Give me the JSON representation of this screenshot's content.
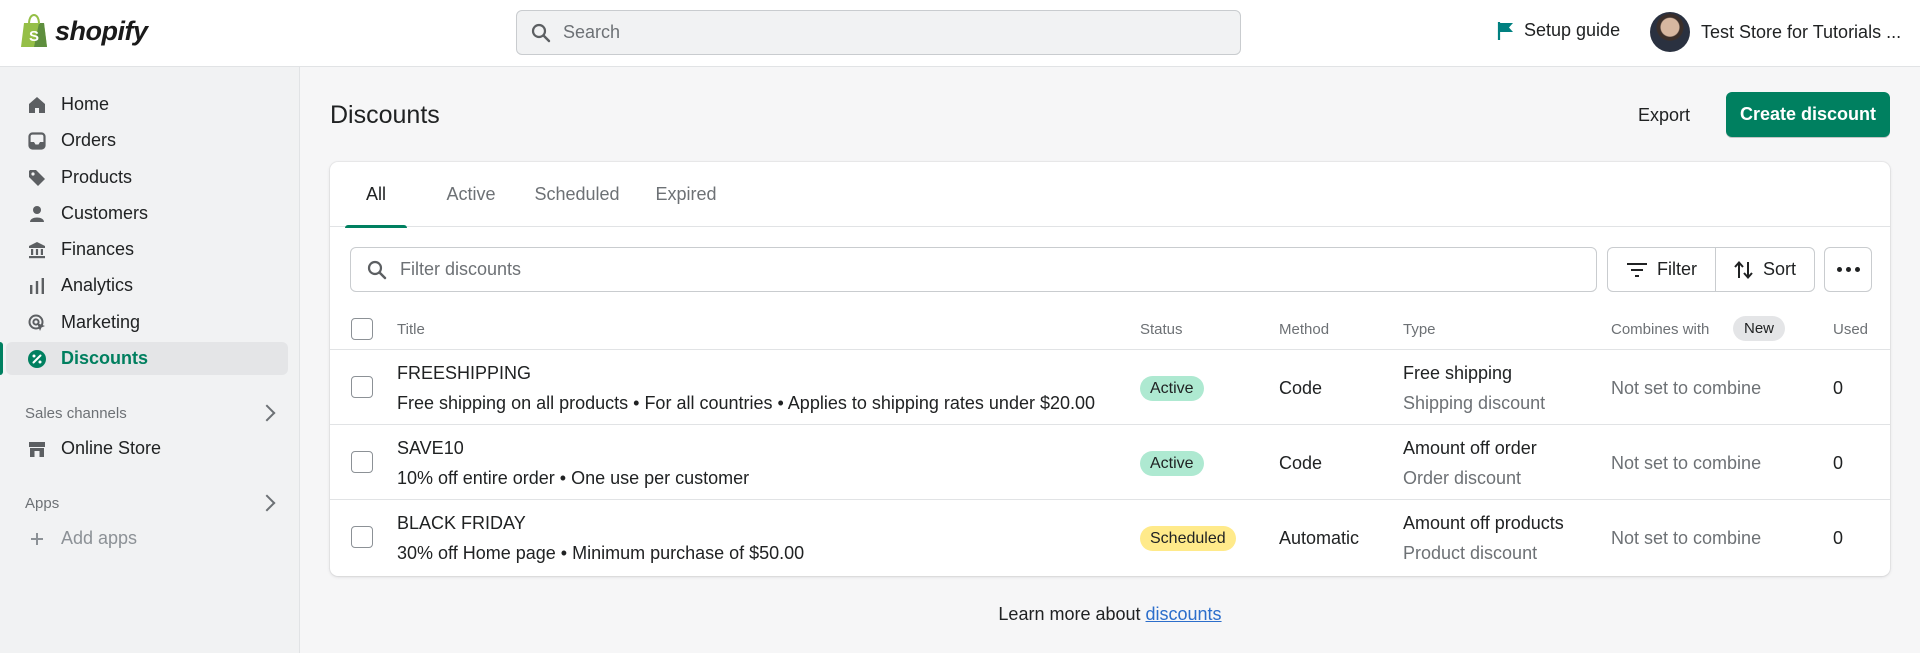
{
  "topbar": {
    "logo_text": "shopify",
    "search_placeholder": "Search",
    "setup_guide": "Setup guide",
    "store_name": "Test Store for Tutorials ..."
  },
  "sidebar": {
    "items": [
      {
        "label": "Home",
        "icon": "home-icon"
      },
      {
        "label": "Orders",
        "icon": "orders-icon"
      },
      {
        "label": "Products",
        "icon": "tag-icon"
      },
      {
        "label": "Customers",
        "icon": "person-icon"
      },
      {
        "label": "Finances",
        "icon": "bank-icon"
      },
      {
        "label": "Analytics",
        "icon": "bar-chart-icon"
      },
      {
        "label": "Marketing",
        "icon": "target-icon"
      },
      {
        "label": "Discounts",
        "icon": "discount-icon",
        "active": true
      }
    ],
    "sales_channels_label": "Sales channels",
    "online_store": "Online Store",
    "apps_label": "Apps",
    "add_apps": "Add apps"
  },
  "page": {
    "title": "Discounts",
    "export_label": "Export",
    "create_label": "Create discount"
  },
  "tabs": [
    "All",
    "Active",
    "Scheduled",
    "Expired"
  ],
  "toolbar": {
    "filter_placeholder": "Filter discounts",
    "filter_label": "Filter",
    "sort_label": "Sort"
  },
  "table": {
    "columns": {
      "title": "Title",
      "status": "Status",
      "method": "Method",
      "type": "Type",
      "combines": "Combines with",
      "new_badge": "New",
      "used": "Used"
    },
    "rows": [
      {
        "title": "FREESHIPPING",
        "description": "Free shipping on all products • For all countries • Applies to shipping rates under $20.00",
        "status": "Active",
        "method": "Code",
        "type": "Free shipping",
        "type_sub": "Shipping discount",
        "combines": "Not set to combine",
        "used": "0"
      },
      {
        "title": "SAVE10",
        "description": "10% off entire order • One use per customer",
        "status": "Active",
        "method": "Code",
        "type": "Amount off order",
        "type_sub": "Order discount",
        "combines": "Not set to combine",
        "used": "0"
      },
      {
        "title": "BLACK FRIDAY",
        "description": "30% off Home page • Minimum purchase of $50.00",
        "status": "Scheduled",
        "method": "Automatic",
        "type": "Amount off products",
        "type_sub": "Product discount",
        "combines": "Not set to combine",
        "used": "0"
      }
    ]
  },
  "footer": {
    "learn_prefix": "Learn more about ",
    "learn_link": "discounts"
  },
  "colors": {
    "accent": "#008060",
    "active_badge": "#aee9d1",
    "scheduled_badge": "#ffea8a",
    "link": "#2c6ecb"
  }
}
